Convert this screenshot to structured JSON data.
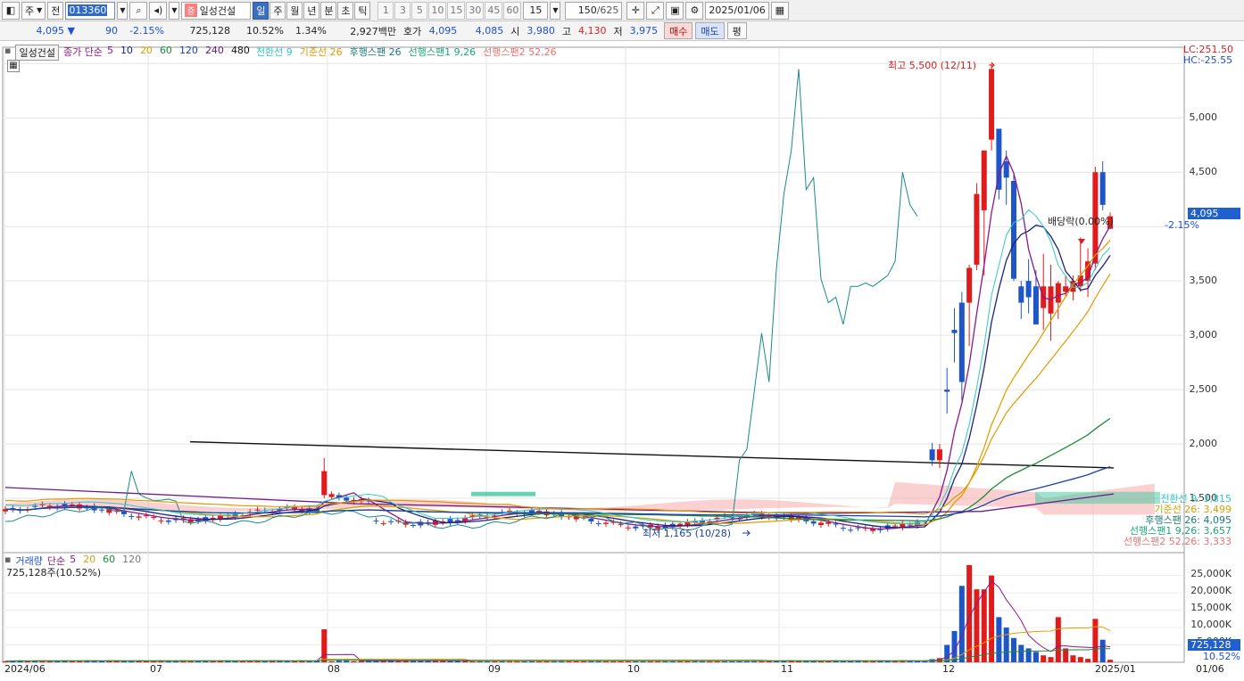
{
  "toolbar": {
    "market": "주",
    "all_label": "전",
    "code": "013360",
    "name_badge": "증",
    "name": "일성건설",
    "periods": [
      "일",
      "주",
      "월",
      "년",
      "분",
      "초",
      "틱"
    ],
    "selected_period": "일",
    "intervals": [
      "1",
      "3",
      "5",
      "10",
      "15",
      "30",
      "45",
      "60"
    ],
    "interval_value": "15",
    "bars_value": "150",
    "bars_total": "/625",
    "date": "2025/01/06"
  },
  "info": {
    "price": "4,095",
    "arrow": "▼",
    "change": "90",
    "change_pct": "-2.15%",
    "volume": "725,128",
    "vol_pct": "10.52%",
    "turnover": "1.34%",
    "amount": "2,927백만",
    "quote_label": "호가",
    "ask": "4,095",
    "bid": "4,085",
    "open_label": "시",
    "open": "3,980",
    "high_label": "고",
    "high": "4,130",
    "low_label": "저",
    "low": "3,975",
    "buy_label": "매수",
    "sell_label": "매도",
    "avg_label": "평"
  },
  "legend": {
    "stock": "일성건설",
    "ma_prefix": "종가 단순",
    "ma_items": [
      {
        "label": "5",
        "color": "#8a1a8a"
      },
      {
        "label": "10",
        "color": "#1a237e"
      },
      {
        "label": "20",
        "color": "#e0a000"
      },
      {
        "label": "60",
        "color": "#1e8a3a"
      },
      {
        "label": "120",
        "color": "#1f3fa8"
      },
      {
        "label": "240",
        "color": "#6a1a8a"
      },
      {
        "label": "480",
        "color": "#111111"
      }
    ],
    "ichimoku": [
      {
        "label": "전환선 9",
        "color": "#30c8c8"
      },
      {
        "label": "기준선 26",
        "color": "#e09a00"
      },
      {
        "label": "후행스팬 26",
        "color": "#1a7a7a"
      },
      {
        "label": "선행스팬1 9,26",
        "color": "#18a878"
      },
      {
        "label": "선행스팬2 52,26",
        "color": "#f07070"
      }
    ]
  },
  "lc": "LC:251.50",
  "hc": "HC:-25.55",
  "annotations": {
    "high": "최고 5,500 (12/11)",
    "low": "최저 1,165 (10/28)",
    "dividend": "배당락(0.00%)"
  },
  "price_axis": [
    "5,000",
    "4,500",
    "3,500",
    "3,000",
    "2,500",
    "2,000",
    "1,500"
  ],
  "current_price": "4,095",
  "current_change": "-2.15%",
  "right_labels": [
    {
      "text": "전환선 9: 3,815",
      "color": "#30c8c8"
    },
    {
      "text": "기준선 26: 3,499",
      "color": "#e09a00"
    },
    {
      "text": "후행스팬 26: 4,095",
      "color": "#1a7a7a"
    },
    {
      "text": "선행스팬1 9,26: 3,657",
      "color": "#18a878"
    },
    {
      "text": "선행스팬2 52,26: 3,333",
      "color": "#f07070"
    }
  ],
  "volume_legend": {
    "title": "거래량",
    "ma_prefix": "단순",
    "items": [
      {
        "label": "5",
        "color": "#8a1a8a"
      },
      {
        "label": "20",
        "color": "#e0a000"
      },
      {
        "label": "60",
        "color": "#1e8a3a"
      },
      {
        "label": "120",
        "color": "#777777"
      }
    ],
    "value": "725,128주(10.52%)"
  },
  "volume_axis": [
    "25,000K",
    "20,000K",
    "15,000K",
    "10,000K",
    "5,000K"
  ],
  "volume_current": "725,128",
  "volume_current_pct": "10.52%",
  "x_axis": [
    "2024/06",
    "07",
    "08",
    "09",
    "10",
    "11",
    "12",
    "2025/01",
    "01/06"
  ],
  "chart_data": {
    "type": "candlestick",
    "price_range": [
      1000,
      5650
    ],
    "volume_range": [
      0,
      29000
    ],
    "candles_recent": [
      {
        "o": 1950,
        "h": 2010,
        "l": 1800,
        "c": 1850
      },
      {
        "o": 1850,
        "h": 2000,
        "l": 1780,
        "c": 1950
      },
      {
        "o": 2500,
        "h": 2700,
        "l": 2280,
        "c": 2480
      },
      {
        "o": 3050,
        "h": 3250,
        "l": 2750,
        "c": 3020
      },
      {
        "o": 3300,
        "h": 3400,
        "l": 2400,
        "c": 2570
      },
      {
        "o": 3300,
        "h": 3650,
        "l": 2900,
        "c": 3620
      },
      {
        "o": 3650,
        "h": 4400,
        "l": 3600,
        "c": 4300
      },
      {
        "o": 4150,
        "h": 4700,
        "l": 3550,
        "c": 4700
      },
      {
        "o": 4800,
        "h": 5500,
        "l": 4700,
        "c": 5450
      },
      {
        "o": 4900,
        "h": 4900,
        "l": 4250,
        "c": 4340
      },
      {
        "o": 4600,
        "h": 4700,
        "l": 4200,
        "c": 4450
      },
      {
        "o": 4420,
        "h": 4500,
        "l": 3500,
        "c": 3520
      },
      {
        "o": 3450,
        "h": 3500,
        "l": 3150,
        "c": 3300
      },
      {
        "o": 3500,
        "h": 3700,
        "l": 3200,
        "c": 3350
      },
      {
        "o": 3450,
        "h": 3600,
        "l": 3100,
        "c": 3100
      },
      {
        "o": 3250,
        "h": 3750,
        "l": 3050,
        "c": 3450
      },
      {
        "o": 3200,
        "h": 3650,
        "l": 2950,
        "c": 3450
      },
      {
        "o": 3300,
        "h": 3500,
        "l": 3150,
        "c": 3480
      },
      {
        "o": 3400,
        "h": 3550,
        "l": 3350,
        "c": 3450
      },
      {
        "o": 3400,
        "h": 3550,
        "l": 3320,
        "c": 3500
      },
      {
        "o": 3450,
        "h": 3900,
        "l": 3400,
        "c": 3550
      },
      {
        "o": 3500,
        "h": 3800,
        "l": 3350,
        "c": 3680
      },
      {
        "o": 3660,
        "h": 4550,
        "l": 3600,
        "c": 4500
      },
      {
        "o": 4500,
        "h": 4600,
        "l": 4150,
        "c": 4200
      },
      {
        "o": 3980,
        "h": 4130,
        "l": 3975,
        "c": 4095
      }
    ],
    "volumes_recent": [
      900,
      1200,
      5000,
      9000,
      22000,
      28000,
      21000,
      21000,
      25000,
      13000,
      10000,
      7000,
      5000,
      4000,
      3000,
      2000,
      1500,
      13000,
      4000,
      2000,
      1500,
      1000,
      12500,
      6500,
      725
    ]
  }
}
